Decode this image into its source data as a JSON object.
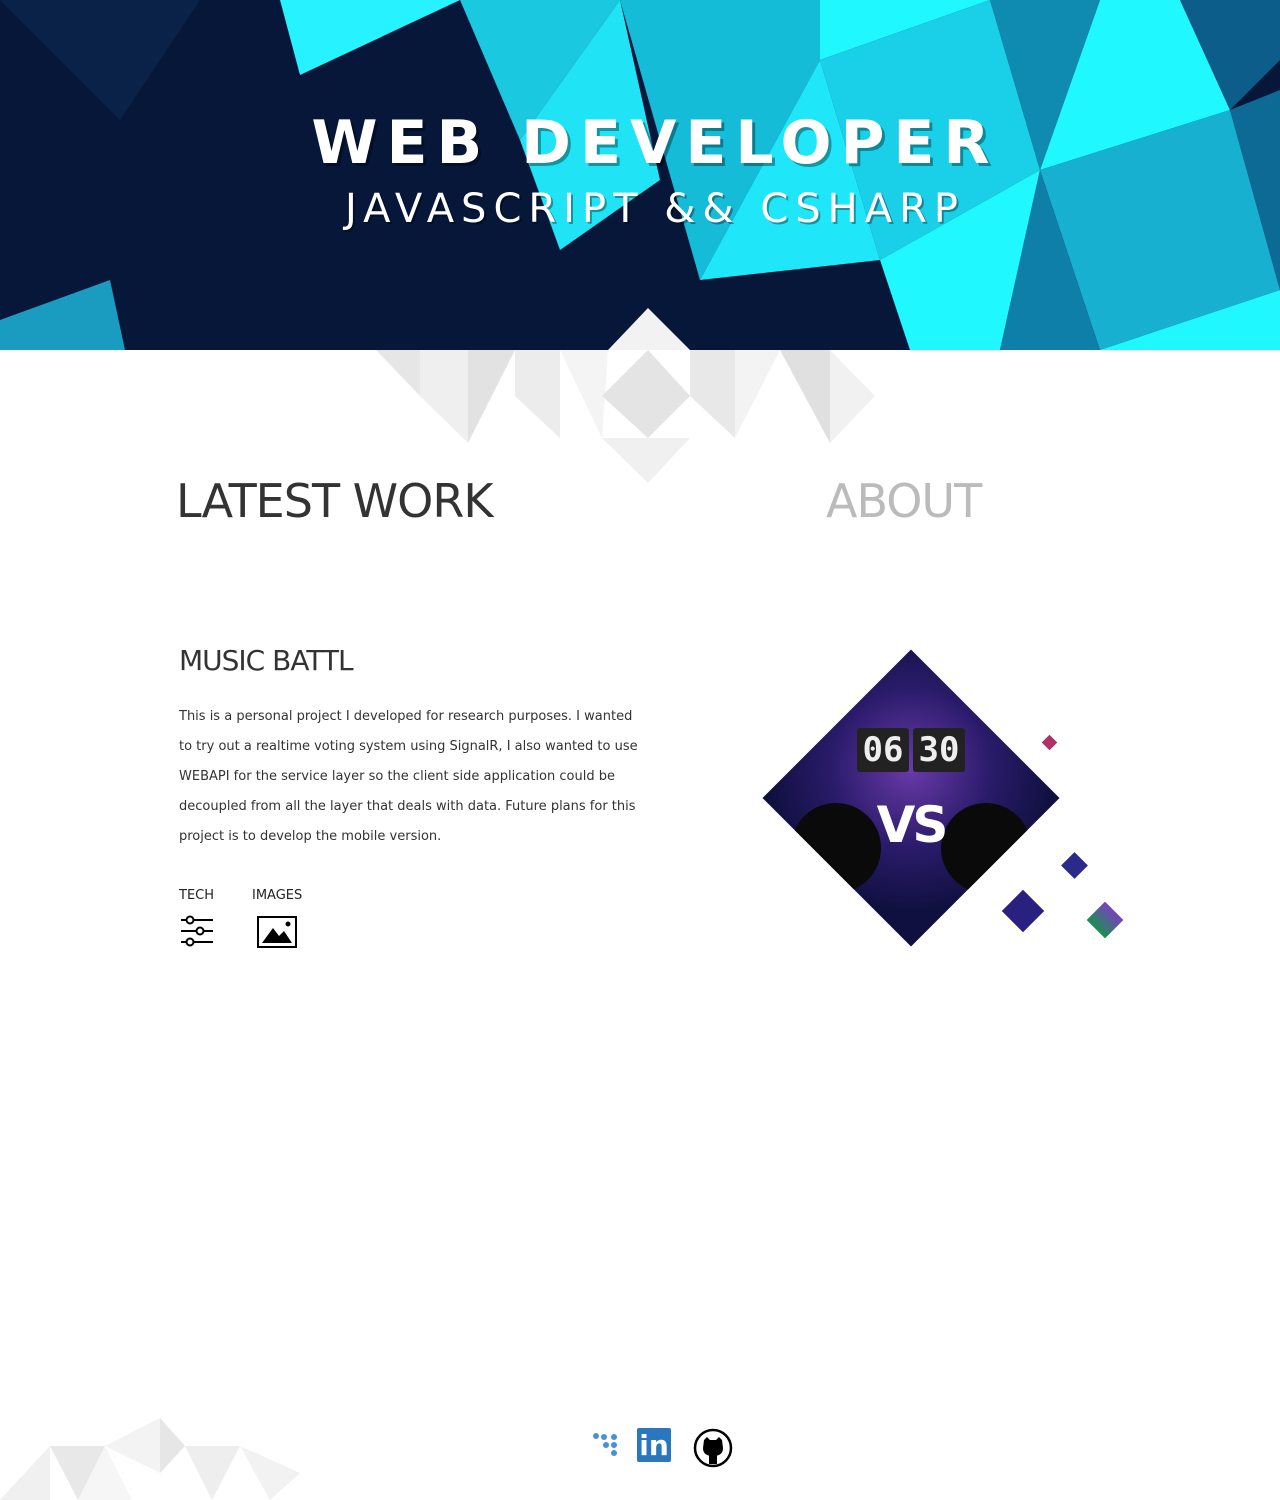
{
  "hero": {
    "title": "WEB DEVELOPER",
    "subtitle": "JAVASCRIPT && CSHARP"
  },
  "nav": {
    "latest": "LATEST WORK",
    "about": "ABOUT"
  },
  "project": {
    "title": "MUSIC BATTL",
    "description": "This is a personal project I developed for research purposes. I wanted to try out a realtime voting system using SignalR, I also wanted to use WEBAPI for the service layer so the client side application could be decoupled from all the layer that deals with data. Future plans for this project is to develop the mobile version.",
    "tech_label": "TECH",
    "images_label": "IMAGES",
    "image": {
      "hour": "06",
      "minute": "30",
      "vs": "VS"
    }
  },
  "social": {
    "links": [
      "treehouse-icon",
      "linkedin-icon",
      "github-icon"
    ],
    "linkedin_text": "in"
  },
  "colors": {
    "navy": "#06173a",
    "cyan": "#1ff8ff",
    "linkedin": "#2b77bd",
    "treehouse": "#4a90d9"
  }
}
